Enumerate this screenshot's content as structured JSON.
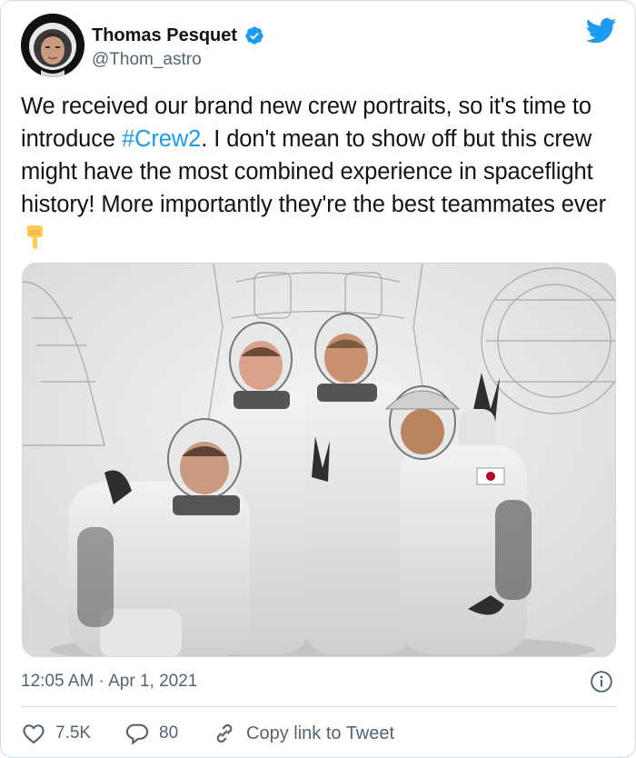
{
  "author": {
    "display_name": "Thomas Pesquet",
    "handle": "@Thom_astro"
  },
  "tweet": {
    "text_before": "We received our brand new crew portraits, so it's time to introduce ",
    "hashtag": "#Crew2",
    "text_after": ". I don't mean to show off but this crew might have the most combined experience in spaceflight history! More importantly they're the best teammates ever",
    "emoji": "backhand-index-pointing-down"
  },
  "meta": {
    "timestamp": "12:05 AM · Apr 1, 2021"
  },
  "actions": {
    "likes": "7.5K",
    "replies": "80",
    "copy_link": "Copy link to Tweet"
  },
  "colors": {
    "accent": "#1d9bf0",
    "text": "#0f1419",
    "muted": "#536471",
    "border": "#cfd9de",
    "like": "#f91880"
  },
  "icons": [
    "twitter-bird-icon",
    "verified-badge-icon",
    "info-icon",
    "heart-icon",
    "reply-bubble-icon",
    "link-icon"
  ]
}
